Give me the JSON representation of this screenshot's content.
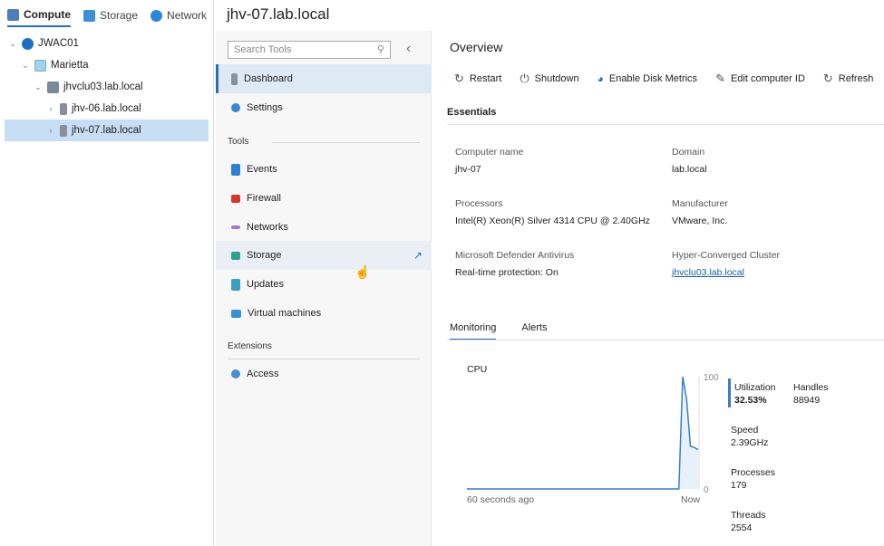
{
  "nav_tabs": [
    {
      "label": "Compute",
      "icon": "server-icon"
    },
    {
      "label": "Storage",
      "icon": "storage-icon"
    },
    {
      "label": "Network",
      "icon": "globe-icon"
    }
  ],
  "tree": [
    {
      "label": "JWAC01",
      "level": 0
    },
    {
      "label": "Marietta",
      "level": 1
    },
    {
      "label": "jhvclu03.lab.local",
      "level": 2
    },
    {
      "label": "jhv-06.lab.local",
      "level": 3
    },
    {
      "label": "jhv-07.lab.local",
      "level": 3,
      "selected": true
    }
  ],
  "page_title": "jhv-07.lab.local",
  "tools": {
    "search_placeholder": "Search Tools",
    "dashboard": "Dashboard",
    "settings": "Settings",
    "tools_heading": "Tools",
    "items": [
      "Events",
      "Firewall",
      "Networks",
      "Storage",
      "Updates",
      "Virtual machines"
    ],
    "extensions_heading": "Extensions",
    "access": "Access"
  },
  "overview": {
    "title": "Overview",
    "actions": [
      "Restart",
      "Shutdown",
      "Enable Disk Metrics",
      "Edit computer ID",
      "Refresh"
    ],
    "essentials": "Essentials",
    "fields": [
      {
        "k": "Computer name",
        "v": "jhv-07"
      },
      {
        "k": "Domain",
        "v": "lab.local"
      },
      {
        "k": "Processors",
        "v": "Intel(R) Xeon(R) Silver 4314 CPU @ 2.40GHz"
      },
      {
        "k": "Manufacturer",
        "v": "VMware, Inc."
      },
      {
        "k": "Microsoft Defender Antivirus",
        "v": "Real-time protection: On"
      },
      {
        "k": "Hyper-Converged Cluster",
        "v": "jhvclu03.lab.local"
      }
    ],
    "tabs": [
      "Monitoring",
      "Alerts"
    ]
  },
  "stats": {
    "utilization_label": "Utilization",
    "utilization": "32.53%",
    "handles_label": "Handles",
    "handles": "88949",
    "speed_label": "Speed",
    "speed": "2.39GHz",
    "processes_label": "Processes",
    "processes": "179",
    "threads_label": "Threads",
    "threads": "2554"
  },
  "chart_data": {
    "type": "area",
    "title": "CPU",
    "xlabel_left": "60 seconds ago",
    "xlabel_right": "Now",
    "ylim": [
      0,
      100
    ],
    "yticks": [
      "100",
      "0"
    ],
    "x": [
      0,
      55,
      56,
      57,
      58,
      59,
      60
    ],
    "values": [
      0,
      0,
      100,
      80,
      38,
      37,
      35
    ],
    "color": "#3a7fc1"
  }
}
